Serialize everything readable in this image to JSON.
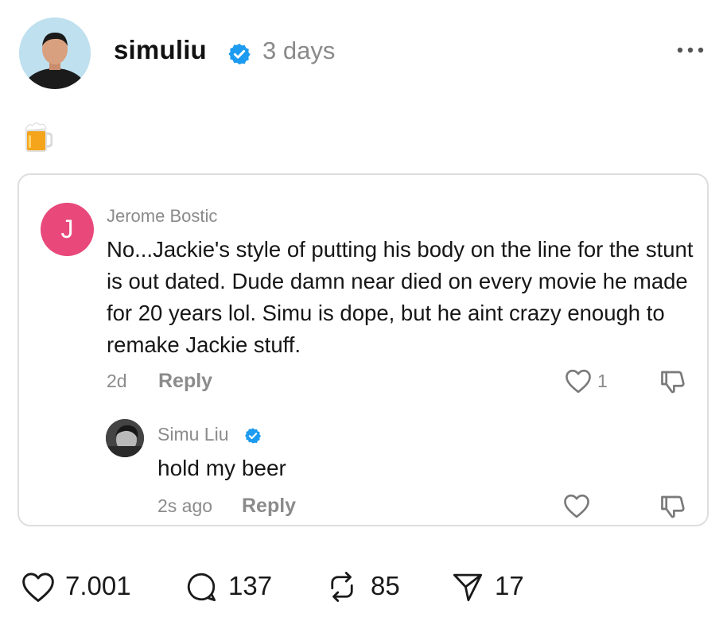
{
  "post": {
    "username": "simuliu",
    "time": "3 days",
    "body_emoji": "🍺"
  },
  "comment": {
    "author_initial": "J",
    "author": "Jerome Bostic",
    "text": "No...Jackie's style of putting his body on the line for the stunt is out dated. Dude damn near died on every movie he made for 20 years lol. Simu is dope, but he aint crazy enough to remake Jackie stuff.",
    "age": "2d",
    "reply_label": "Reply",
    "likes": "1"
  },
  "reply": {
    "author": "Simu Liu",
    "text": "hold my beer",
    "age": "2s ago",
    "reply_label": "Reply"
  },
  "actions": {
    "likes": "7.001",
    "comments": "137",
    "reposts": "85",
    "shares": "17"
  },
  "colors": {
    "verified": "#1d9bf0",
    "initial_avatar": "#e8487a",
    "muted_text": "#8b8b8b",
    "card_border": "#dedede"
  },
  "icons": [
    "verified-badge-icon",
    "more-options-icon",
    "beer-mug-icon",
    "heart-icon",
    "thumbs-down-icon",
    "comment-icon",
    "repost-icon",
    "share-icon"
  ]
}
